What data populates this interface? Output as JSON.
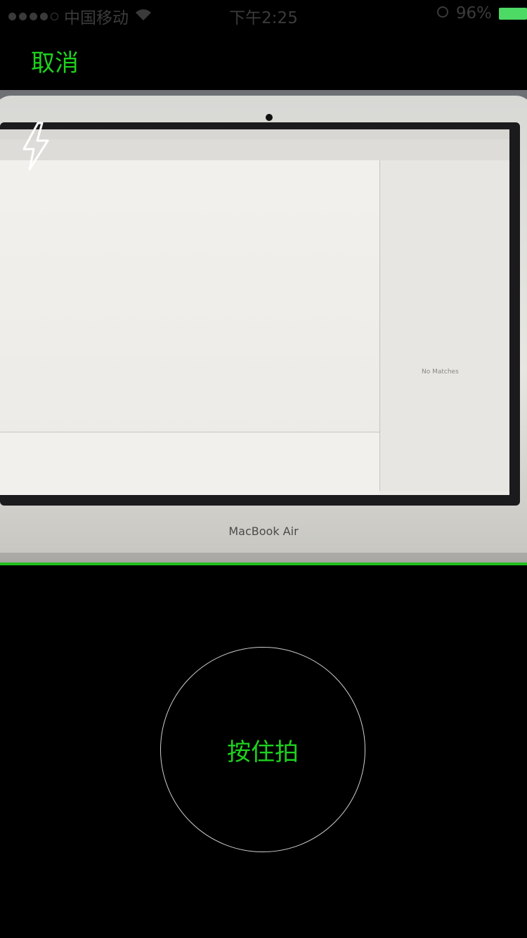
{
  "status_bar": {
    "carrier": "中国移动",
    "time": "下午2:25",
    "battery": "96%"
  },
  "top_bar": {
    "cancel_label": "取消"
  },
  "preview": {
    "laptop_brand": "MacBook Air",
    "inspector_no_matches": "No Matches",
    "flash_icon": "flash-icon"
  },
  "bottom": {
    "shutter_label": "按住拍"
  },
  "colors": {
    "accent_green": "#1ed11e",
    "divider_green": "#1fbf1f",
    "battery_green": "#4cd964"
  }
}
